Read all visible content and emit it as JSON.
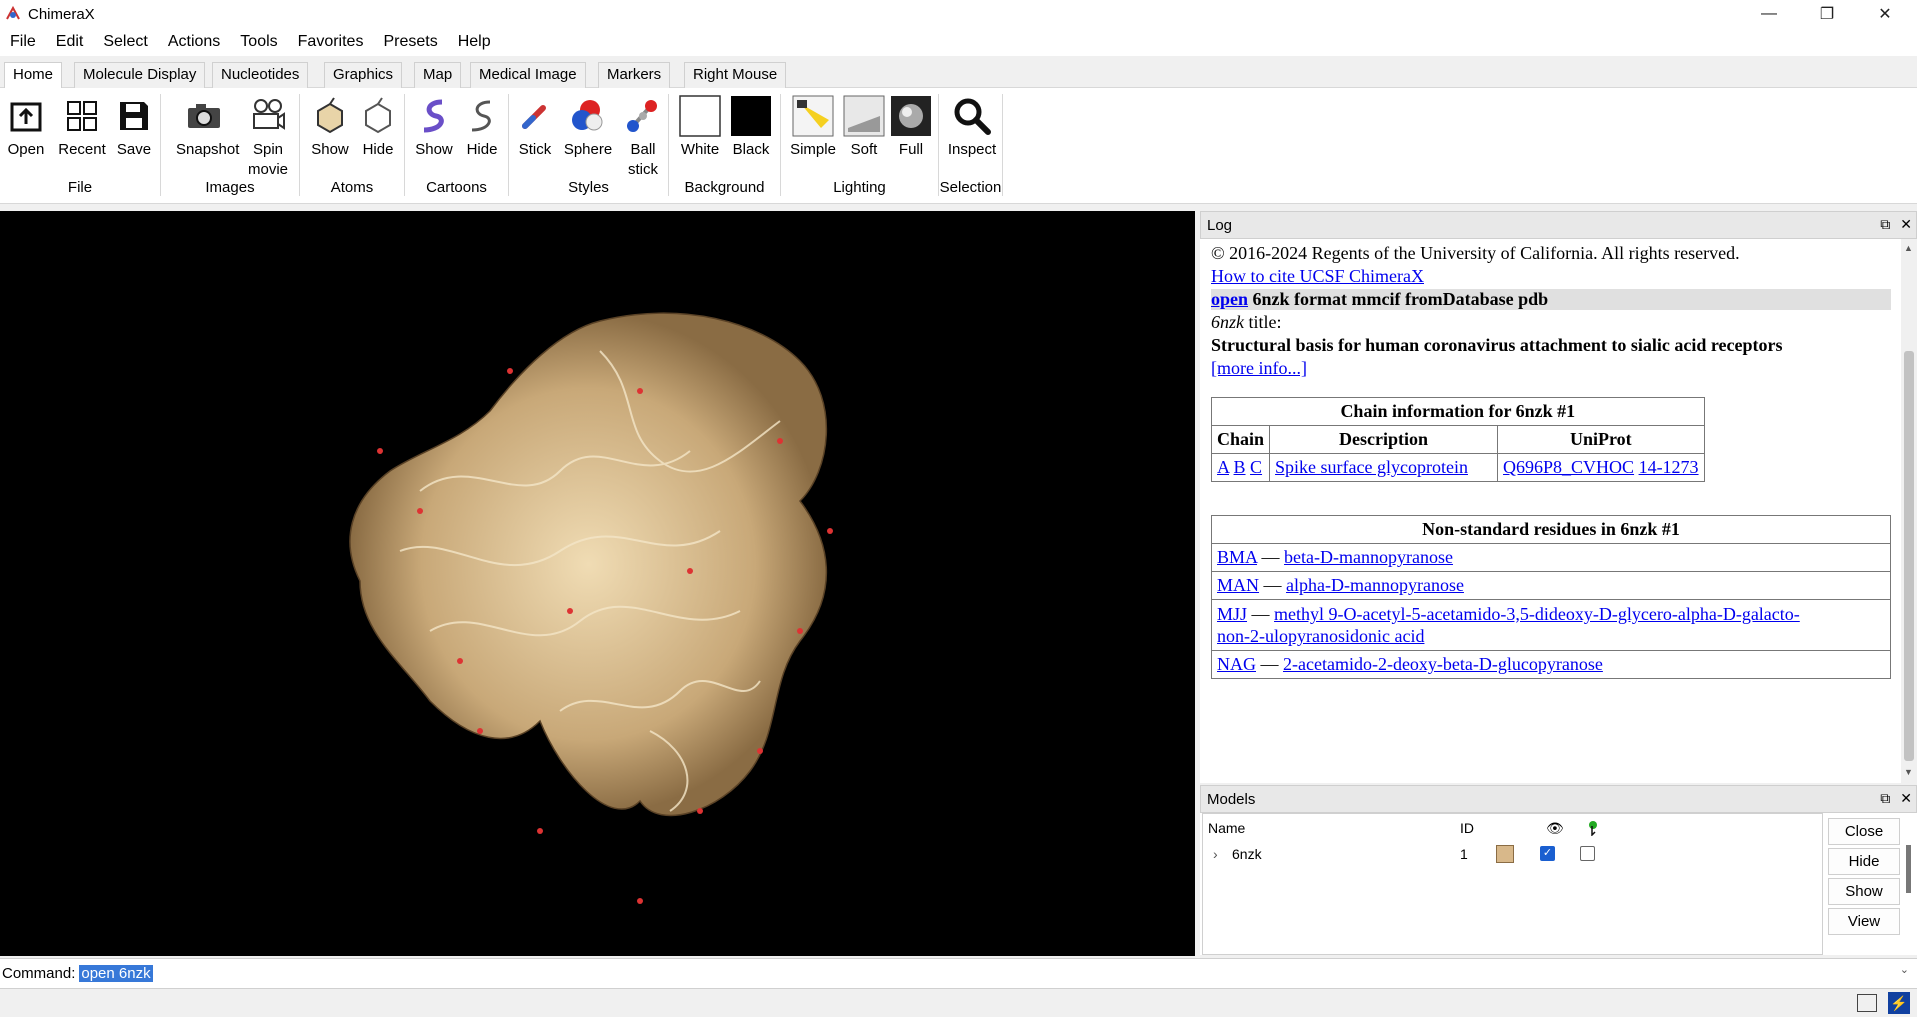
{
  "window": {
    "title": "ChimeraX",
    "minimize_glyph": "—",
    "restore_glyph": "❐",
    "close_glyph": "✕"
  },
  "menu": [
    "File",
    "Edit",
    "Select",
    "Actions",
    "Tools",
    "Favorites",
    "Presets",
    "Help"
  ],
  "tabs": [
    "Home",
    "Molecule Display",
    "Nucleotides",
    "Graphics",
    "Map",
    "Medical Image",
    "Markers",
    "Right Mouse"
  ],
  "ribbon": {
    "buttons": [
      {
        "label": "Open",
        "icon": "open-icon"
      },
      {
        "label": "Recent",
        "icon": "recent-icon"
      },
      {
        "label": "Save",
        "icon": "save-icon"
      },
      {
        "label": "Snapshot",
        "icon": "camera-icon"
      },
      {
        "label": "Spin movie",
        "icon": "film-camera-icon"
      },
      {
        "label": "Show",
        "icon": "atoms-show-icon"
      },
      {
        "label": "Hide",
        "icon": "atoms-hide-icon"
      },
      {
        "label": "Show",
        "icon": "cartoon-show-icon"
      },
      {
        "label": "Hide",
        "icon": "cartoon-hide-icon"
      },
      {
        "label": "Stick",
        "icon": "stick-icon"
      },
      {
        "label": "Sphere",
        "icon": "sphere-icon"
      },
      {
        "label": "Ball stick",
        "icon": "ball-stick-icon"
      },
      {
        "label": "White",
        "icon": "white-background-icon"
      },
      {
        "label": "Black",
        "icon": "black-background-icon"
      },
      {
        "label": "Simple",
        "icon": "simple-lighting-icon"
      },
      {
        "label": "Soft",
        "icon": "soft-lighting-icon"
      },
      {
        "label": "Full",
        "icon": "full-lighting-icon"
      },
      {
        "label": "Inspect",
        "icon": "magnifier-icon"
      }
    ],
    "groups": [
      "File",
      "Images",
      "Atoms",
      "Cartoons",
      "Styles",
      "Background",
      "Lighting",
      "Selection"
    ]
  },
  "log": {
    "title": "Log",
    "copyright": "© 2016-2024 Regents of the University of California. All rights reserved.",
    "cite_link": "How to cite UCSF ChimeraX",
    "cmd_link": "open",
    "cmd_rest": "6nzk format mmcif fromDatabase pdb",
    "title_id": "6nzk",
    "title_word": "title:",
    "structure_title": "Structural basis for human coronavirus attachment to sialic acid receptors",
    "more_info": "[more info...]",
    "chain_table": {
      "caption": "Chain information for 6nzk #1",
      "headers": [
        "Chain",
        "Description",
        "UniProt"
      ],
      "chains": [
        "A",
        "B",
        "C"
      ],
      "description": "Spike surface glycoprotein",
      "uniprot": "Q696P8_CVHOC",
      "range": "14-1273"
    },
    "residue_table": {
      "caption": "Non-standard residues in 6nzk #1",
      "dash": "—",
      "rows": [
        {
          "code": "BMA",
          "name": "beta-D-mannopyranose"
        },
        {
          "code": "MAN",
          "name": "alpha-D-mannopyranose"
        },
        {
          "code": "MJJ",
          "name": "methyl 9-O-acetyl-5-acetamido-3,5-dideoxy-D-glycero-alpha-D-galacto-",
          "name2": "non-2-ulopyranosidonic acid"
        },
        {
          "code": "NAG",
          "name": "2-acetamido-2-deoxy-beta-D-glucopyranose"
        }
      ]
    }
  },
  "models": {
    "title": "Models",
    "headers": {
      "name": "Name",
      "id": "ID"
    },
    "row": {
      "name": "6nzk",
      "id": "1",
      "color": "#d8b88a",
      "displayed": true,
      "selected": false
    },
    "buttons": [
      "Close",
      "Hide",
      "Show",
      "View"
    ]
  },
  "command": {
    "label": "Command:",
    "value": "open 6nzk"
  },
  "colors": {
    "accent": "#3778d8",
    "link": "#0000ee",
    "molecule": "#d8b88a"
  }
}
